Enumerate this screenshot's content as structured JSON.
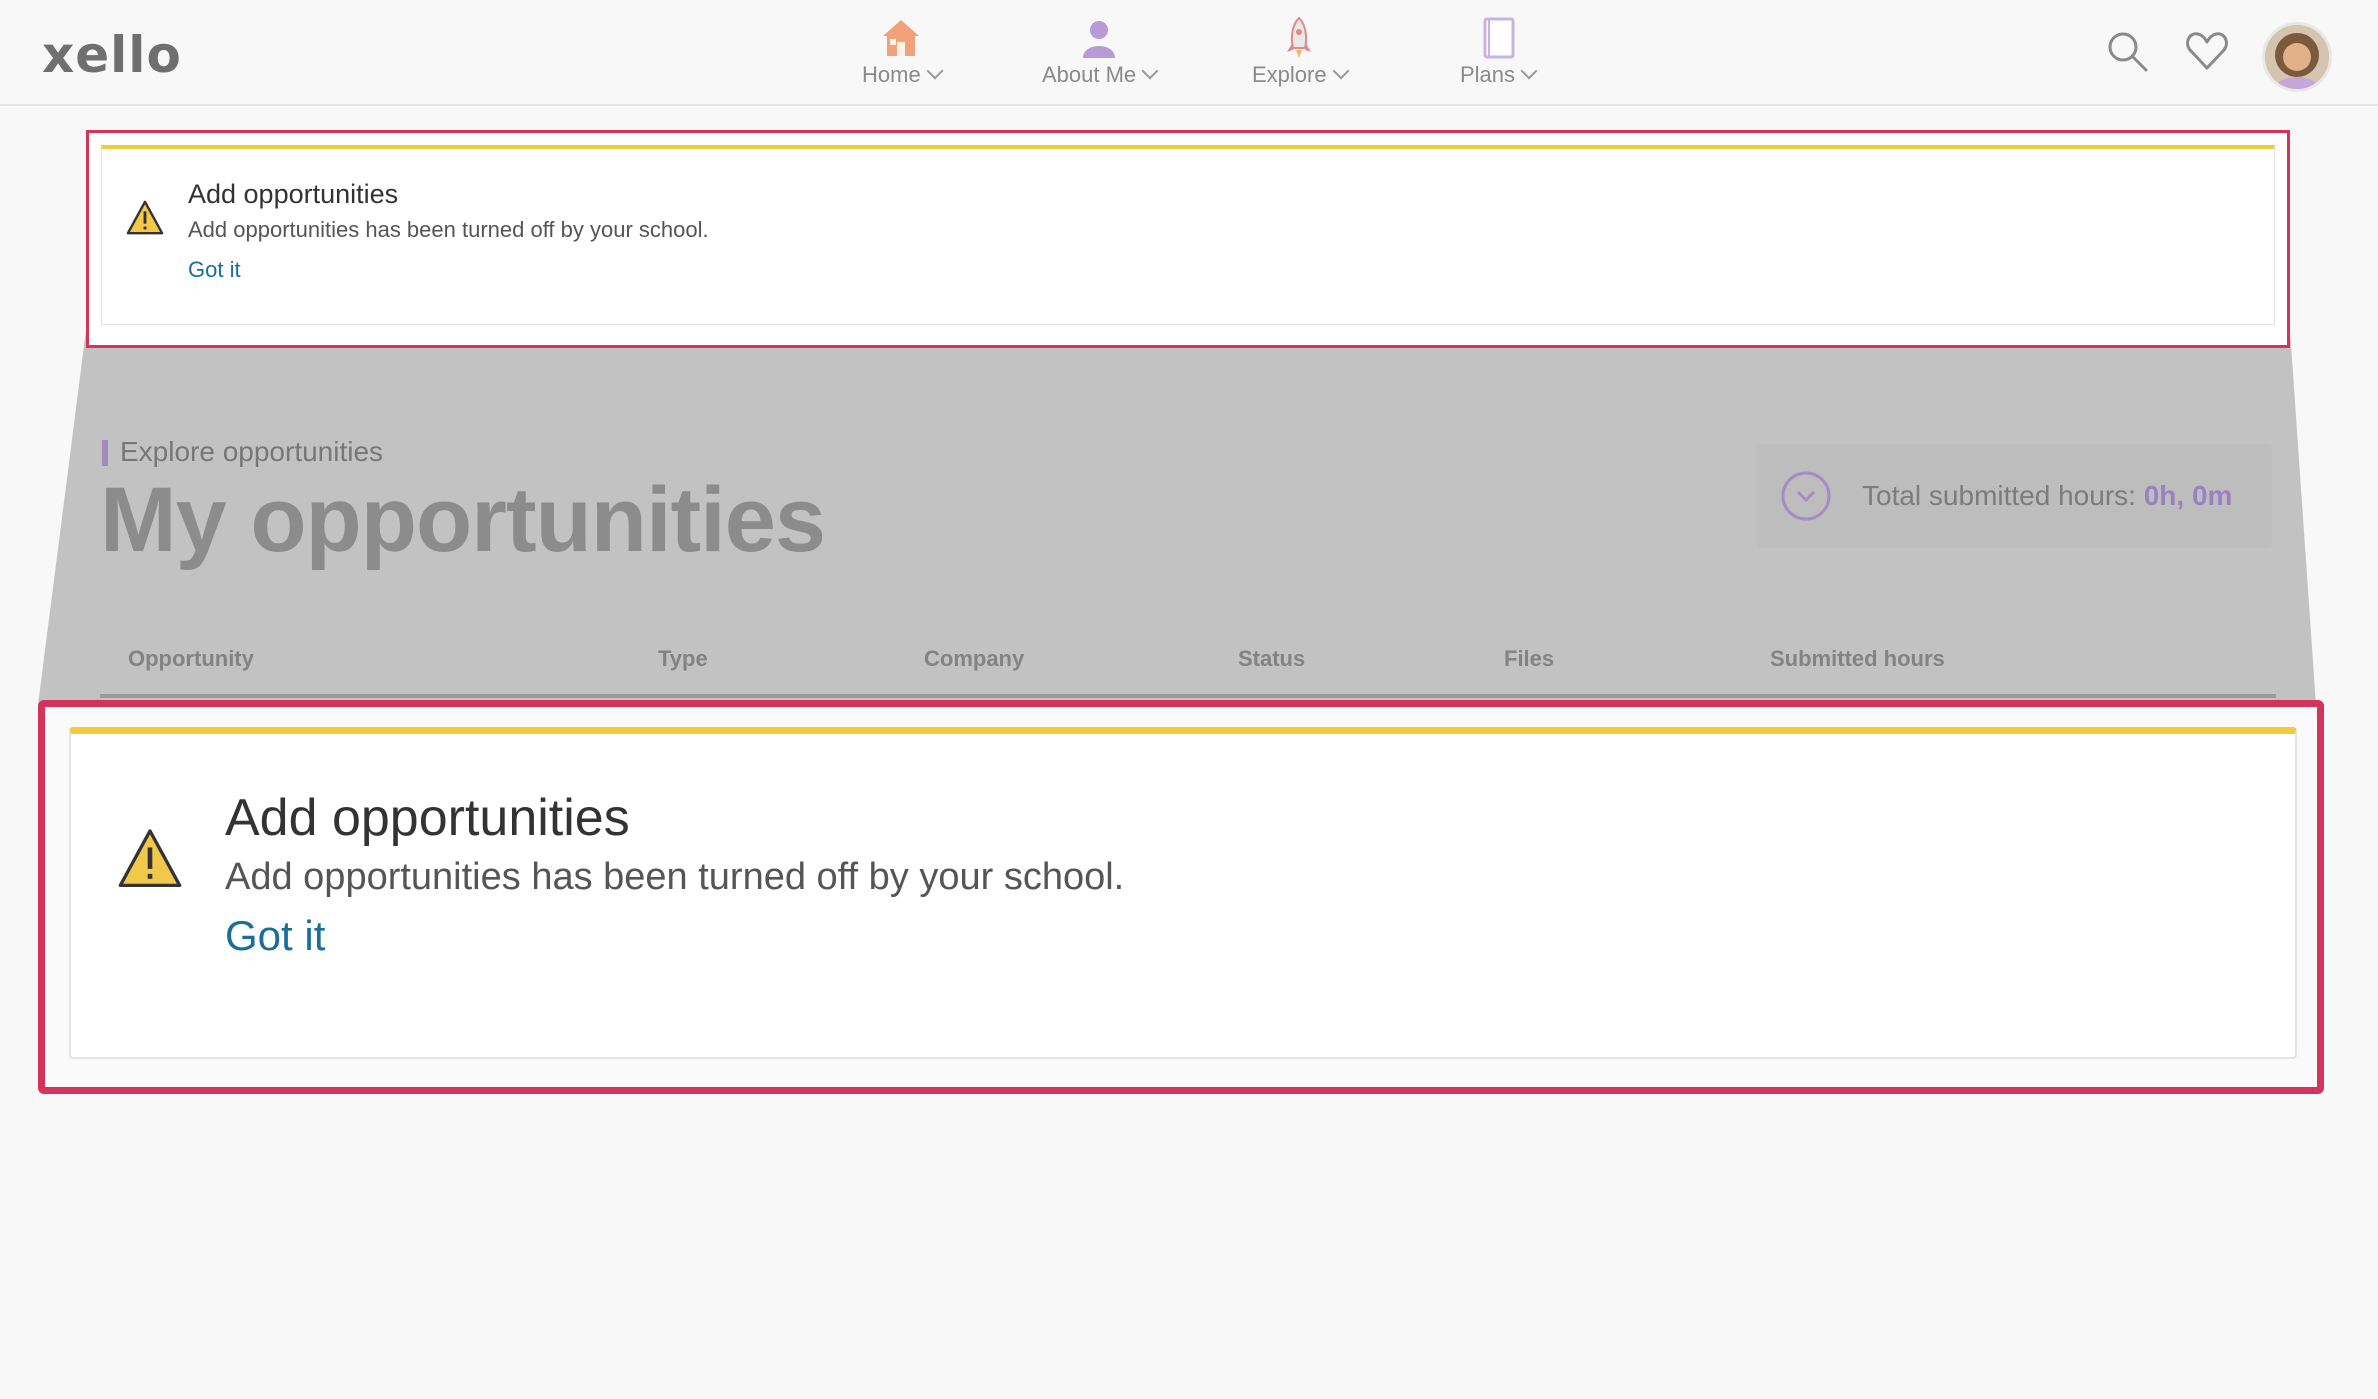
{
  "app": {
    "logo": "xello"
  },
  "nav": {
    "items": [
      {
        "label": "Home",
        "icon": "home-icon"
      },
      {
        "label": "About Me",
        "icon": "person-icon"
      },
      {
        "label": "Explore",
        "icon": "rocket-icon"
      },
      {
        "label": "Plans",
        "icon": "notebook-icon"
      }
    ],
    "right_icons": [
      "search-icon",
      "heart-icon",
      "avatar"
    ]
  },
  "alert": {
    "title": "Add opportunities",
    "message": "Add opportunities has been turned off by your school.",
    "action": "Got it"
  },
  "page": {
    "breadcrumb": "Explore opportunities",
    "title": "My opportunities",
    "hours_label": "Total submitted hours: ",
    "hours_value": "0h, 0m",
    "columns": [
      "Opportunity",
      "Type",
      "Company",
      "Status",
      "Files",
      "Submitted hours"
    ]
  },
  "colors": {
    "highlight": "#d4345a",
    "alert_accent": "#f2cc3f",
    "link": "#1a6f9a"
  }
}
